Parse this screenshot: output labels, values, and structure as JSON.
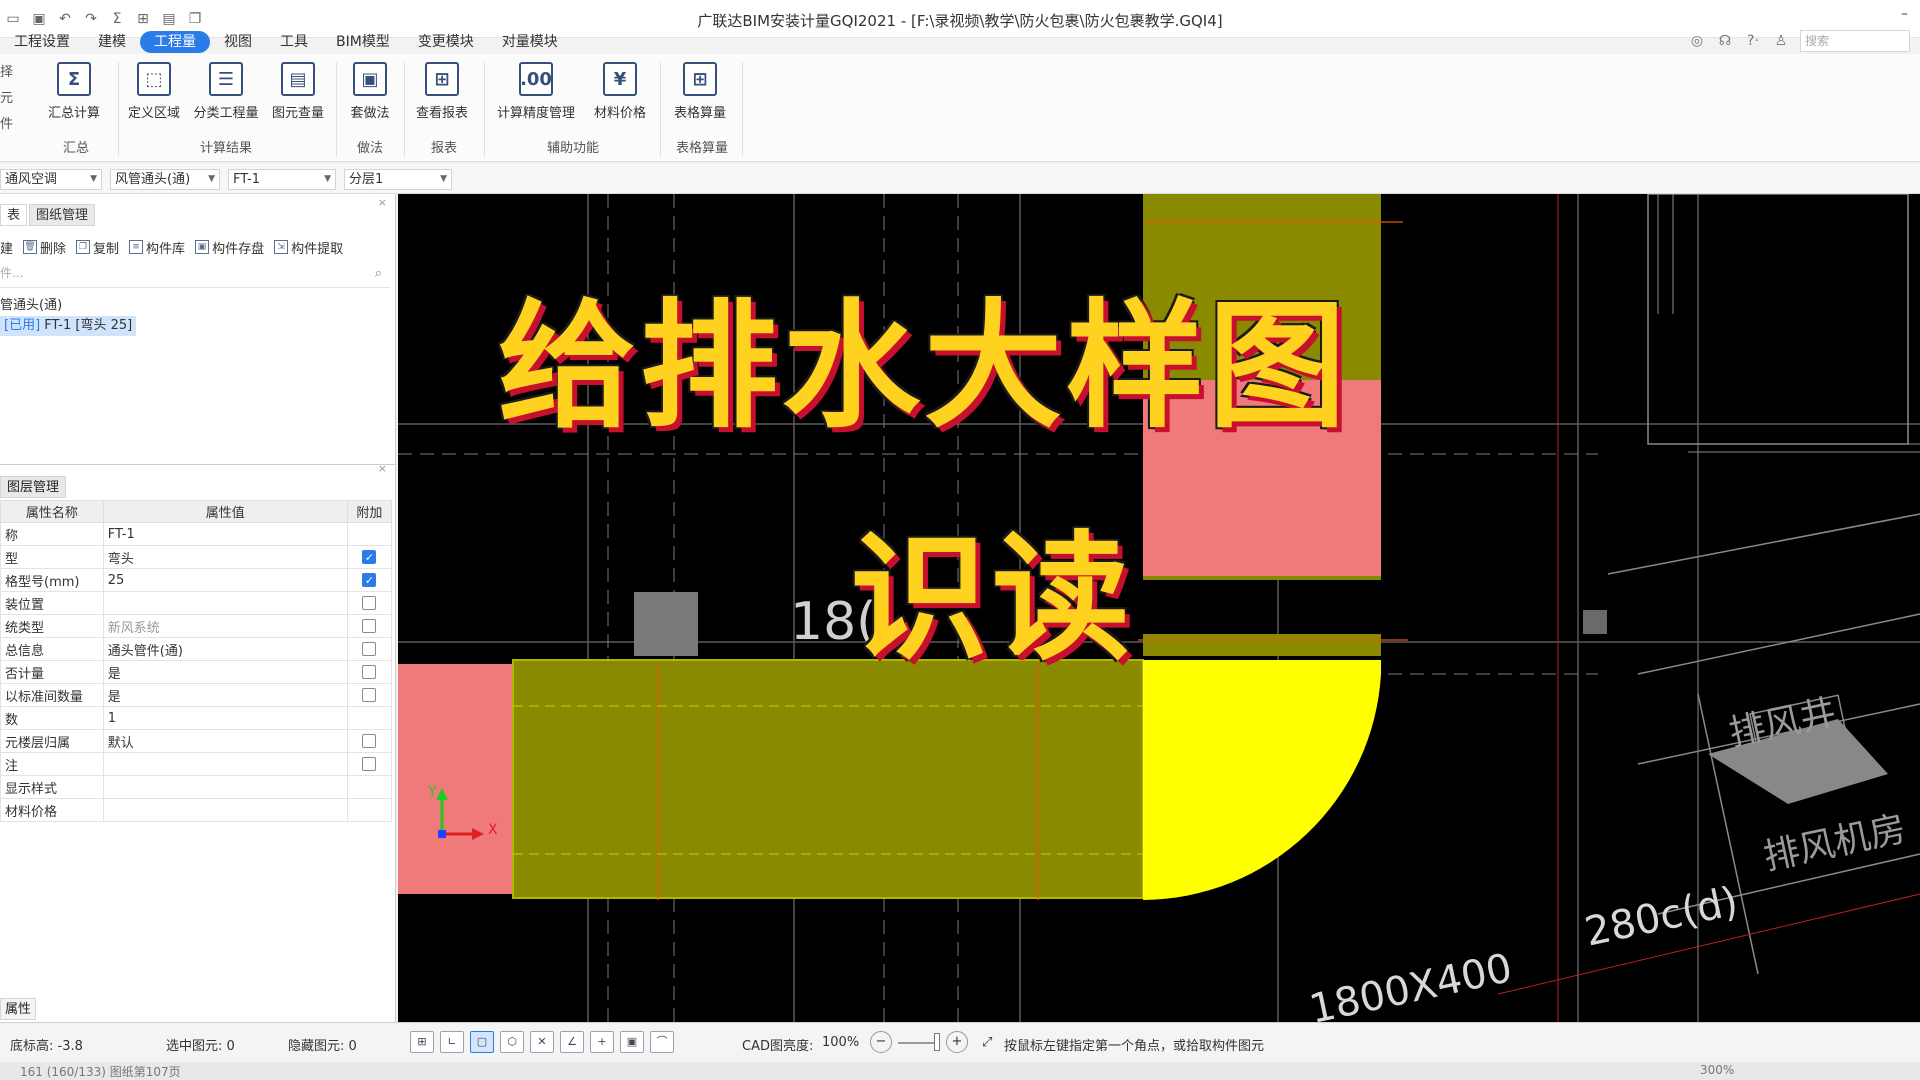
{
  "window": {
    "title": "广联达BIM安装计量GQI2021 - [F:\\录视频\\教学\\防火包裹\\防火包裹教学.GQI4]",
    "minimize_glyph": "–"
  },
  "quick_access": [
    "folder-open-icon",
    "save-icon",
    "undo-icon",
    "redo-icon",
    "sum-icon",
    "grid-icon",
    "table-icon",
    "window-icon"
  ],
  "menu": {
    "tabs": [
      {
        "label": "工程设置",
        "active": false
      },
      {
        "label": "建模",
        "active": false
      },
      {
        "label": "工程量",
        "active": true
      },
      {
        "label": "视图",
        "active": false
      },
      {
        "label": "工具",
        "active": false
      },
      {
        "label": "BIM模型",
        "active": false
      },
      {
        "label": "变更模块",
        "active": false
      },
      {
        "label": "对量模块",
        "active": false
      }
    ],
    "search_placeholder": "搜索",
    "right_icons": [
      "user-icon",
      "headset-icon",
      "help-icon",
      "shirt-icon"
    ],
    "help_glyph": "?·"
  },
  "ribbon": {
    "left_stub": [
      "择",
      "元",
      "件"
    ],
    "groups": [
      {
        "name": "汇总",
        "buttons": [
          {
            "label": "汇总计算",
            "glyph": "Σ"
          }
        ]
      },
      {
        "name": "计算结果",
        "buttons": [
          {
            "label": "定义区域",
            "glyph": "⬚"
          },
          {
            "label": "分类工程量",
            "glyph": "☰"
          },
          {
            "label": "图元查量",
            "glyph": "▤"
          }
        ]
      },
      {
        "name": "做法",
        "buttons": [
          {
            "label": "套做法",
            "glyph": "▣"
          }
        ]
      },
      {
        "name": "报表",
        "buttons": [
          {
            "label": "查看报表",
            "glyph": "⊞"
          }
        ]
      },
      {
        "name": "辅助功能",
        "buttons": [
          {
            "label": "计算精度管理",
            "glyph": ".00"
          },
          {
            "label": "材料价格",
            "glyph": "¥"
          }
        ]
      },
      {
        "name": "表格算量",
        "buttons": [
          {
            "label": "表格算量",
            "glyph": "⊞"
          }
        ]
      }
    ]
  },
  "dropdowns": [
    {
      "value": "通风空调"
    },
    {
      "value": "风管通头(通)"
    },
    {
      "value": "FT-1"
    },
    {
      "value": "分层1"
    }
  ],
  "component_panel": {
    "tabs": [
      "表",
      "图纸管理"
    ],
    "close_glyph": "×",
    "tools": [
      {
        "label": "删除",
        "icon": "delete-icon"
      },
      {
        "label": "复制",
        "icon": "copy-icon"
      },
      {
        "label": "构件库",
        "icon": "library-icon"
      },
      {
        "label": "构件存盘",
        "icon": "save-component-icon"
      },
      {
        "label": "构件提取",
        "icon": "extract-icon"
      }
    ],
    "tool_prefix": "建",
    "search_placeholder": "件...",
    "tree_parent": "管通头(通)",
    "tree_item_tag": "[已用]",
    "tree_item_label": "FT-1 [弯头 25]"
  },
  "property_panel": {
    "tab": "图层管理",
    "close_glyph": "×",
    "headers": [
      "属性名称",
      "属性值",
      "附加"
    ],
    "rows": [
      {
        "name": "称",
        "value": "FT-1",
        "check": null,
        "grey": false
      },
      {
        "name": "型",
        "value": "弯头",
        "check": true,
        "grey": false
      },
      {
        "name": "格型号(mm)",
        "value": "25",
        "check": true,
        "grey": false
      },
      {
        "name": "装位置",
        "value": "",
        "check": false,
        "grey": false
      },
      {
        "name": "统类型",
        "value": "新风系统",
        "check": false,
        "grey": true
      },
      {
        "name": "总信息",
        "value": "通头管件(通)",
        "check": false,
        "grey": false
      },
      {
        "name": "否计量",
        "value": "是",
        "check": false,
        "grey": false
      },
      {
        "name": "以标准间数量",
        "value": "是",
        "check": false,
        "grey": false
      },
      {
        "name": "数",
        "value": "1",
        "check": null,
        "grey": false
      },
      {
        "name": "元楼层归属",
        "value": "默认",
        "check": false,
        "grey": false
      },
      {
        "name": "注",
        "value": "",
        "check": false,
        "grey": false
      },
      {
        "name": "显示样式",
        "value": "",
        "check": null,
        "grey": false
      },
      {
        "name": "材料价格",
        "value": "",
        "check": null,
        "grey": false
      }
    ],
    "bottom_tab": "属性"
  },
  "canvas": {
    "title_line1": "给排水大样图",
    "title_line2": "识读",
    "labels": {
      "dim_partial": "18(",
      "exhaust_shaft": "排风井",
      "exhaust_room": "排风机房",
      "dim_280": "280c(d)",
      "dim_1800": "1800X400"
    },
    "axis": {
      "x": "X",
      "y": "Y"
    },
    "colors": {
      "background": "#000000",
      "duct_olive": "#8a8a00",
      "duct_pink": "#f07a7a",
      "duct_yellow": "#ffff00",
      "title_fill": "#ffd21f",
      "title_shadow": "#c8102e"
    }
  },
  "status": {
    "floor_height": "底标高: -3.8",
    "selected": "选中图元: 0",
    "hidden": "隐藏图元: 0",
    "cad_brightness_label": "CAD图亮度:",
    "cad_brightness_value": "100%",
    "hint": "按鼠标左键指定第一个角点，或拾取构件图元",
    "tool_icons": [
      "grid-snap-icon",
      "ortho-icon",
      "select-box-icon",
      "cube-icon",
      "angle-icon",
      "plus-snap-icon",
      "layer-icon",
      "arc-icon"
    ],
    "zoom_out": "−",
    "zoom_in": "+",
    "bottom_text": "161 (160/133)     图纸第107页",
    "bottom_zoom": "300%"
  }
}
